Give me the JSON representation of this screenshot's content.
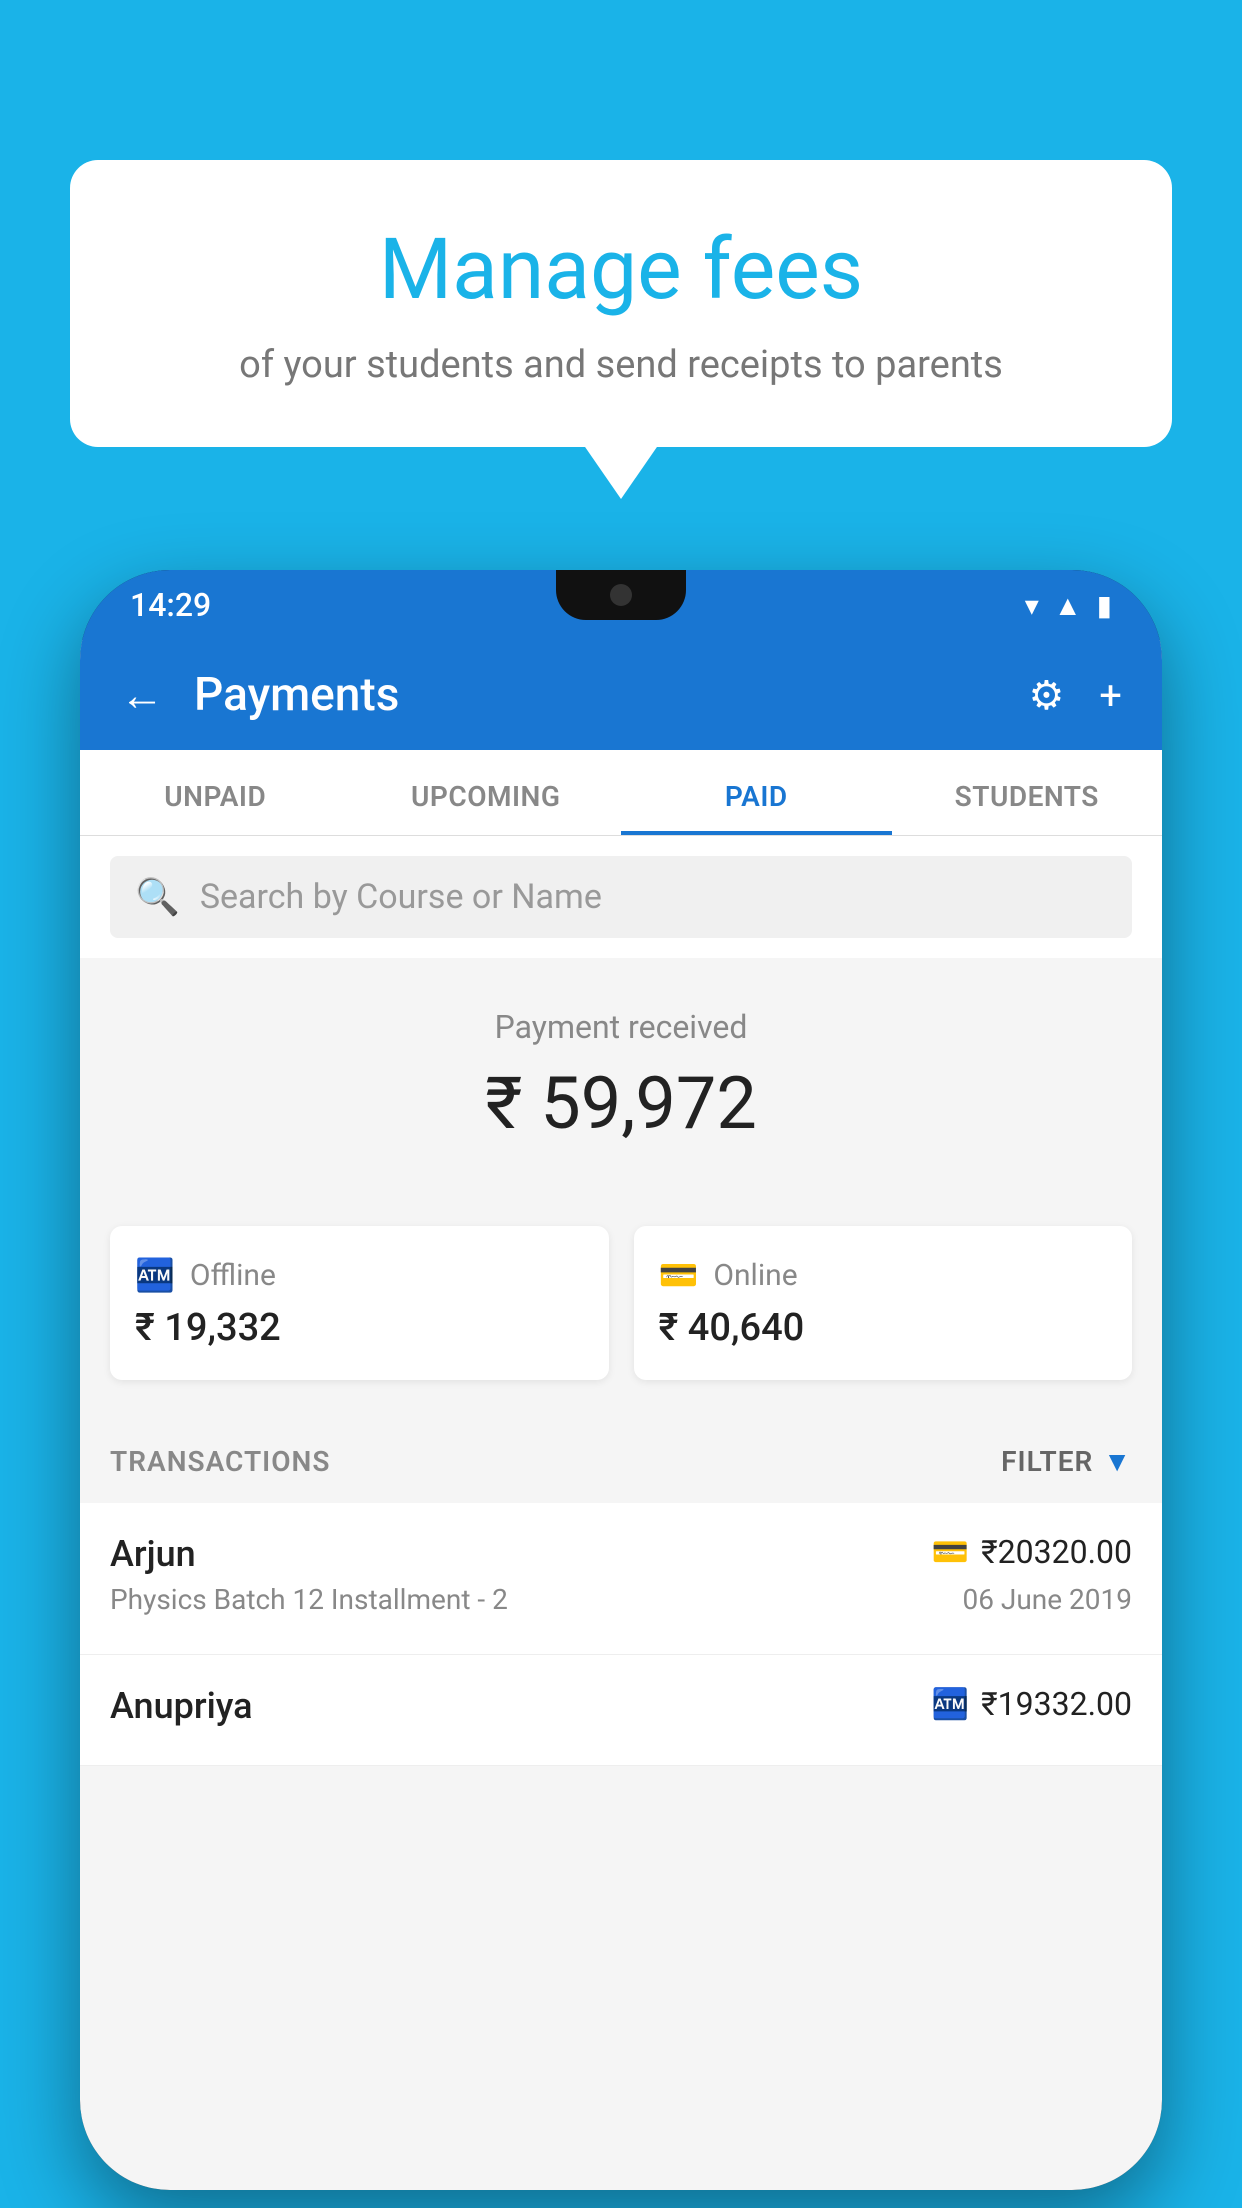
{
  "background_color": "#1ab3e8",
  "bubble": {
    "title": "Manage fees",
    "subtitle": "of your students and send receipts to parents"
  },
  "status_bar": {
    "time": "14:29",
    "icons": [
      "wifi",
      "signal",
      "battery"
    ]
  },
  "header": {
    "back_icon": "←",
    "title": "Payments",
    "settings_icon": "⚙",
    "add_icon": "+"
  },
  "tabs": [
    {
      "label": "UNPAID",
      "active": false
    },
    {
      "label": "UPCOMING",
      "active": false
    },
    {
      "label": "PAID",
      "active": true
    },
    {
      "label": "STUDENTS",
      "active": false
    }
  ],
  "search": {
    "placeholder": "Search by Course or Name",
    "search_icon": "🔍"
  },
  "payment_summary": {
    "label": "Payment received",
    "amount": "₹ 59,972",
    "offline": {
      "type": "Offline",
      "amount": "₹ 19,332"
    },
    "online": {
      "type": "Online",
      "amount": "₹ 40,640"
    }
  },
  "transactions": {
    "label": "TRANSACTIONS",
    "filter_label": "FILTER",
    "items": [
      {
        "name": "Arjun",
        "detail": "Physics Batch 12 Installment - 2",
        "amount": "₹20320.00",
        "date": "06 June 2019",
        "payment_type": "online"
      },
      {
        "name": "Anupriya",
        "detail": "",
        "amount": "₹19332.00",
        "date": "",
        "payment_type": "offline"
      }
    ]
  }
}
